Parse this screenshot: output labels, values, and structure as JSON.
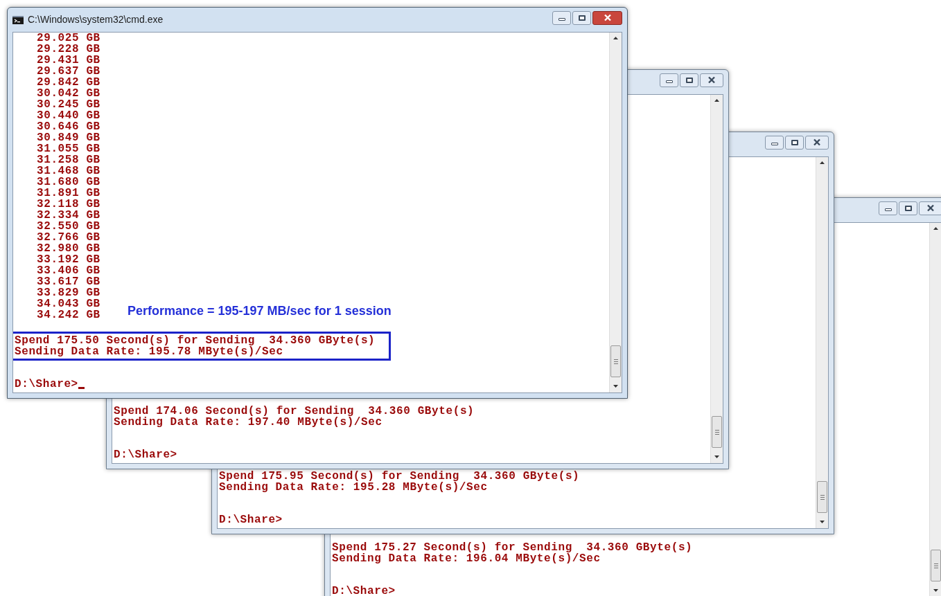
{
  "windows": [
    {
      "title": "C:\\Windows\\system32\\cmd.exe",
      "active": true,
      "output_lines": [
        "29.025 GB",
        "29.228 GB",
        "29.431 GB",
        "29.637 GB",
        "29.842 GB",
        "30.042 GB",
        "30.245 GB",
        "30.440 GB",
        "30.646 GB",
        "30.849 GB",
        "31.055 GB",
        "31.258 GB",
        "31.468 GB",
        "31.680 GB",
        "31.891 GB",
        "32.118 GB",
        "32.334 GB",
        "32.550 GB",
        "32.766 GB",
        "32.980 GB",
        "33.192 GB",
        "33.406 GB",
        "33.617 GB",
        "33.829 GB",
        "34.043 GB",
        "34.242 GB"
      ],
      "annotation": "Performance = 195-197 MB/sec for 1 session",
      "highlighted": true,
      "result_lines": [
        "Spend 175.50 Second(s) for Sending  34.360 GByte(s)",
        "Sending Data Rate: 195.78 MByte(s)/Sec"
      ],
      "prompt": "D:\\Share>",
      "cursor": true
    },
    {
      "active": false,
      "result_lines": [
        "Spend 174.06 Second(s) for Sending  34.360 GByte(s)",
        "Sending Data Rate: 197.40 MByte(s)/Sec"
      ],
      "prompt": "D:\\Share>"
    },
    {
      "active": false,
      "result_lines": [
        "Spend 175.95 Second(s) for Sending  34.360 GByte(s)",
        "Sending Data Rate: 195.28 MByte(s)/Sec"
      ],
      "prompt": "D:\\Share>"
    },
    {
      "active": false,
      "result_lines": [
        "Spend 175.27 Second(s) for Sending  34.360 GByte(s)",
        "Sending Data Rate: 196.04 MByte(s)/Sec"
      ],
      "prompt": "D:\\Share>"
    }
  ]
}
